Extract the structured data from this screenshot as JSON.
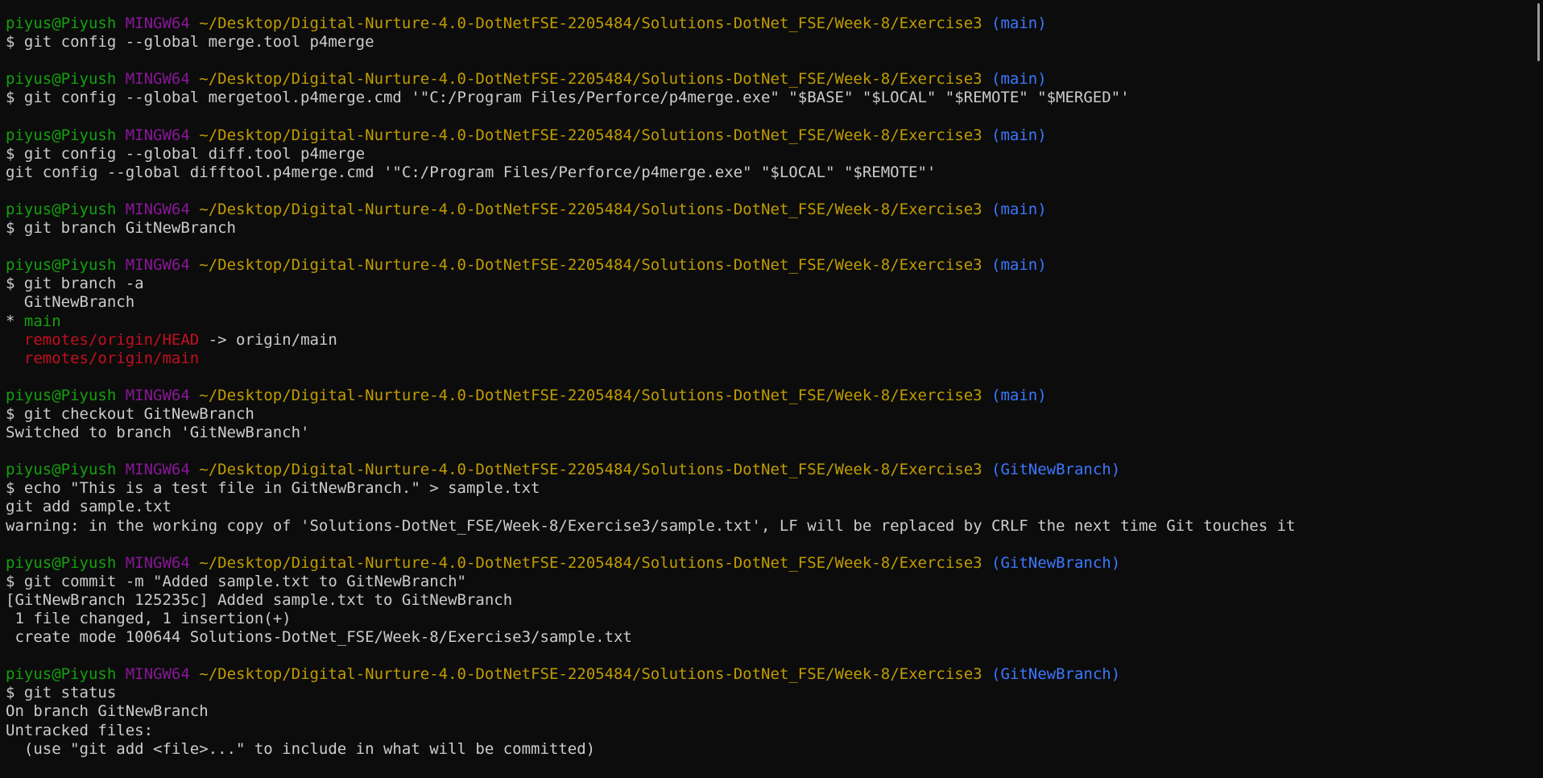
{
  "prompt": {
    "user_host": "piyus@Piyush",
    "shell": "MINGW64",
    "path": "~/Desktop/Digital-Nurture-4.0-DotNetFSE-2205484/Solutions-DotNet_FSE/Week-8/Exercise3"
  },
  "colors": {
    "background": "#0c0c0c",
    "text": "#cccccc",
    "user": "#13a10e",
    "host": "#881798",
    "path": "#c19c00",
    "branch": "#3b78ff",
    "remote": "#c50f1f",
    "current_branch": "#13a10e"
  },
  "blocks": [
    {
      "branch": "(main)",
      "command": "$ git config --global merge.tool p4merge",
      "output": []
    },
    {
      "branch": "(main)",
      "command": "$ git config --global mergetool.p4merge.cmd '\"C:/Program Files/Perforce/p4merge.exe\" \"$BASE\" \"$LOCAL\" \"$REMOTE\" \"$MERGED\"'",
      "output": []
    },
    {
      "branch": "(main)",
      "command": "$ git config --global diff.tool p4merge",
      "output": [
        {
          "text": "git config --global difftool.p4merge.cmd '\"C:/Program Files/Perforce/p4merge.exe\" \"$LOCAL\" \"$REMOTE\"'",
          "color": "text"
        }
      ]
    },
    {
      "branch": "(main)",
      "command": "$ git branch GitNewBranch",
      "output": []
    },
    {
      "branch": "(main)",
      "command": "$ git branch -a",
      "output": [
        {
          "text": "  GitNewBranch",
          "color": "text"
        },
        {
          "text": "* main",
          "color": "green",
          "prefix": "* ",
          "rest": "main"
        },
        {
          "text": "  remotes/origin/HEAD -> origin/main",
          "color": "mixed",
          "prefix": "  ",
          "red": "remotes/origin/HEAD",
          "rest": " -> origin/main"
        },
        {
          "text": "  remotes/origin/main",
          "color": "red",
          "prefix": "  ",
          "red": "remotes/origin/main",
          "rest": ""
        }
      ]
    },
    {
      "branch": "(main)",
      "command": "$ git checkout GitNewBranch",
      "output": [
        {
          "text": "Switched to branch 'GitNewBranch'",
          "color": "text"
        }
      ]
    },
    {
      "branch": "(GitNewBranch)",
      "command": "$ echo \"This is a test file in GitNewBranch.\" > sample.txt",
      "output": [
        {
          "text": "git add sample.txt",
          "color": "text"
        },
        {
          "text": "warning: in the working copy of 'Solutions-DotNet_FSE/Week-8/Exercise3/sample.txt', LF will be replaced by CRLF the next time Git touches it",
          "color": "text"
        }
      ]
    },
    {
      "branch": "(GitNewBranch)",
      "command": "$ git commit -m \"Added sample.txt to GitNewBranch\"",
      "output": [
        {
          "text": "[GitNewBranch 125235c] Added sample.txt to GitNewBranch",
          "color": "text"
        },
        {
          "text": " 1 file changed, 1 insertion(+)",
          "color": "text"
        },
        {
          "text": " create mode 100644 Solutions-DotNet_FSE/Week-8/Exercise3/sample.txt",
          "color": "text"
        }
      ]
    },
    {
      "branch": "(GitNewBranch)",
      "command": "$ git status",
      "output": [
        {
          "text": "On branch GitNewBranch",
          "color": "text"
        },
        {
          "text": "Untracked files:",
          "color": "text"
        },
        {
          "text": "  (use \"git add <file>...\" to include in what will be committed)",
          "color": "text"
        }
      ]
    }
  ]
}
